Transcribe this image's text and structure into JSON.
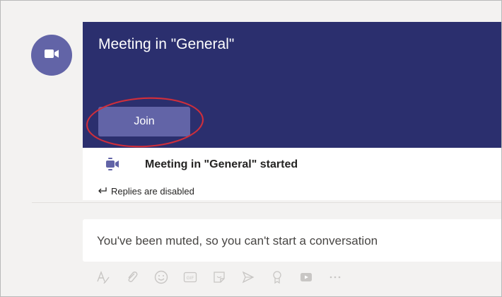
{
  "meeting_card": {
    "title": "Meeting in \"General\"",
    "join_label": "Join",
    "started_text": "Meeting in \"General\" started",
    "replies_text": "Replies are disabled"
  },
  "compose": {
    "muted_message": "You've been muted, so you can't start a conversation",
    "toolbar_icons": [
      "format-icon",
      "attach-icon",
      "emoji-icon",
      "gif-icon",
      "sticker-icon",
      "meet-now-icon",
      "praise-icon",
      "stream-icon",
      "more-options-icon"
    ],
    "gif_label": "GIF"
  },
  "colors": {
    "banner": "#2b2f6e",
    "accent": "#6264a7",
    "highlight_ring": "#d32f3a",
    "disabled_icon": "#c8c6c4"
  }
}
